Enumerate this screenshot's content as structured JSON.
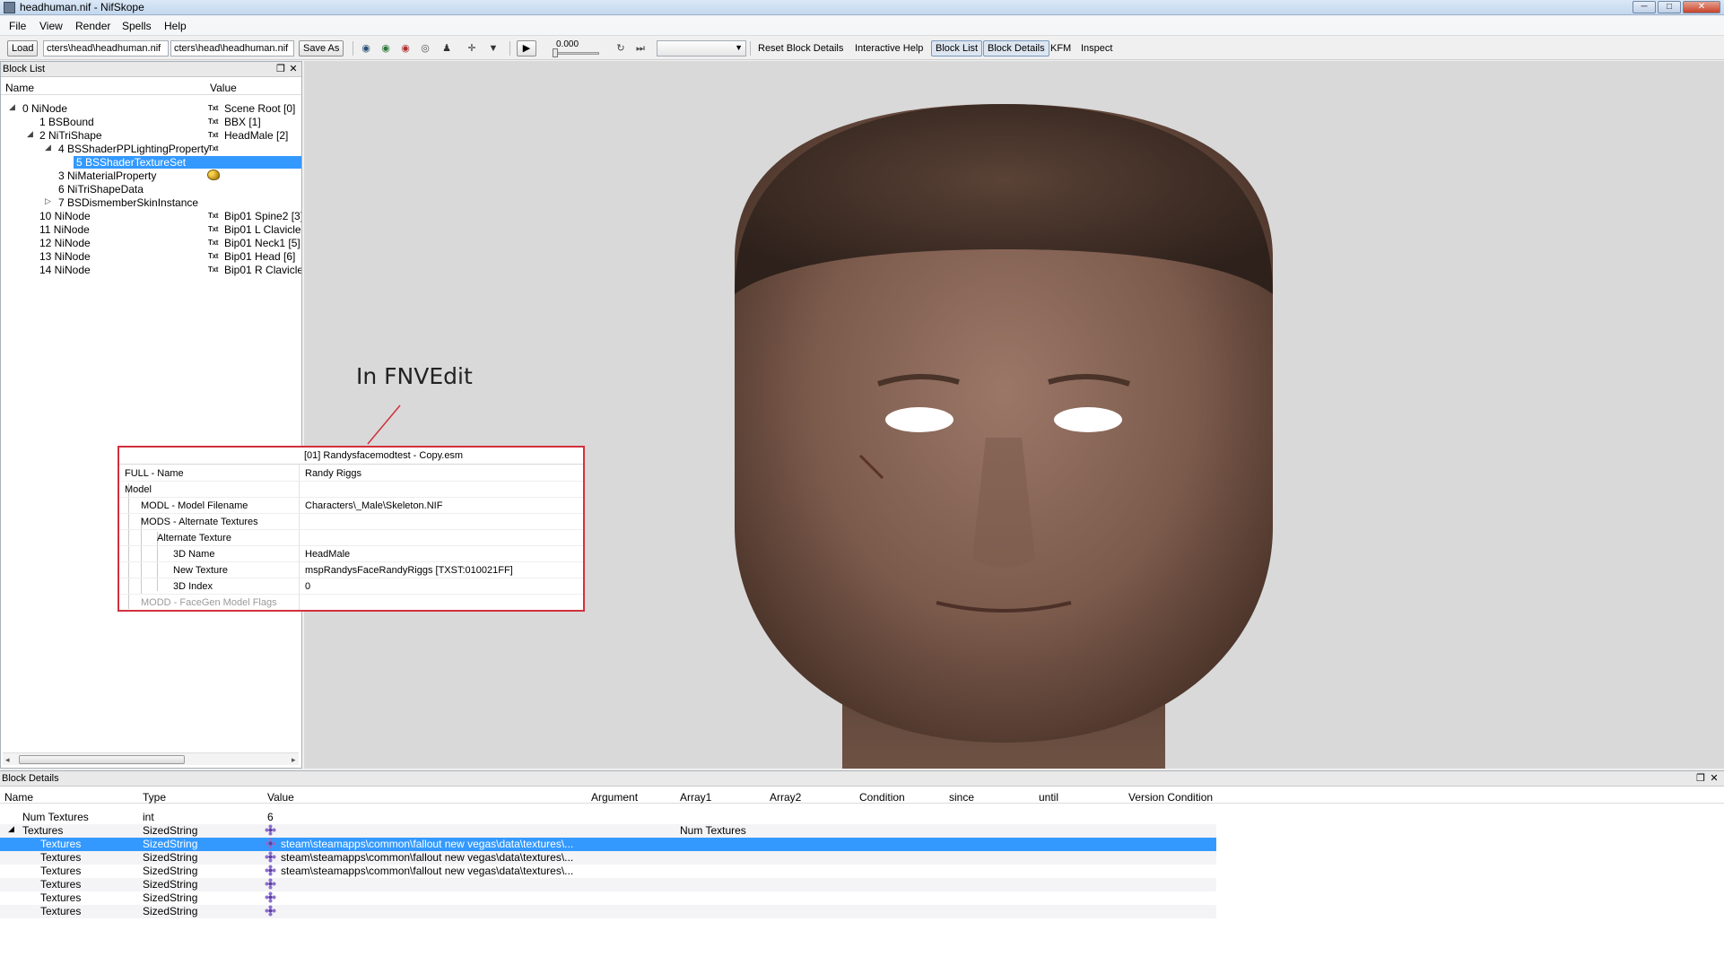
{
  "window": {
    "title": "headhuman.nif - NifSkope",
    "minimize": "─",
    "maximize": "□",
    "close": "✕"
  },
  "menu": [
    "File",
    "View",
    "Render",
    "Spells",
    "Help"
  ],
  "toolbar": {
    "load_label": "Load",
    "load_path": "cters\\head\\headhuman.nif",
    "save_path": "cters\\head\\headhuman.nif",
    "save_as_label": "Save As",
    "time_value": "0.000",
    "reset_block_details": "Reset Block Details",
    "interactive_help": "Interactive Help",
    "block_list": "Block List",
    "block_details": "Block Details",
    "kfm": "KFM",
    "inspect": "Inspect",
    "icons": [
      "eye-blue-icon",
      "eye-green-icon",
      "eye-red-icon",
      "eye-outline-icon",
      "walk-icon",
      "move-axis-icon",
      "dropdown-icon",
      "play-icon",
      "loop-icon",
      "switch-icon"
    ]
  },
  "block_list": {
    "title": "Block List",
    "col_name": "Name",
    "col_value": "Value",
    "txt_badge": "Txt",
    "rows": [
      {
        "name": "0 NiNode",
        "value": "Scene Root [0]",
        "txt": true,
        "expander": "◢"
      },
      {
        "name": "1 BSBound",
        "value": "BBX [1]",
        "txt": true,
        "expander": ""
      },
      {
        "name": "2 NiTriShape",
        "value": "HeadMale [2]",
        "txt": true,
        "expander": "◢"
      },
      {
        "name": "4 BSShaderPPLightingProperty",
        "value": "",
        "txt": true,
        "expander": "◢"
      },
      {
        "name": "5 BSShaderTextureSet",
        "value": "",
        "txt": false,
        "expander": ""
      },
      {
        "name": "3 NiMaterialProperty",
        "value": "",
        "txt": false,
        "expander": ""
      },
      {
        "name": "6 NiTriShapeData",
        "value": "",
        "txt": false,
        "expander": ""
      },
      {
        "name": "7 BSDismemberSkinInstance",
        "value": "",
        "txt": false,
        "expander": "▷"
      },
      {
        "name": "10 NiNode",
        "value": "Bip01 Spine2 [3]",
        "txt": true,
        "expander": ""
      },
      {
        "name": "11 NiNode",
        "value": "Bip01 L Clavicle [",
        "txt": true,
        "expander": ""
      },
      {
        "name": "12 NiNode",
        "value": "Bip01 Neck1 [5]",
        "txt": true,
        "expander": ""
      },
      {
        "name": "13 NiNode",
        "value": "Bip01 Head [6]",
        "txt": true,
        "expander": ""
      },
      {
        "name": "14 NiNode",
        "value": "Bip01 R Clavicle",
        "txt": true,
        "expander": ""
      }
    ]
  },
  "annotation": {
    "label": "In FNVEdit"
  },
  "fnvedit": {
    "header": "[01] Randysfacemodtest - Copy.esm",
    "rows": [
      {
        "key": "FULL - Name",
        "value": "Randy Riggs"
      },
      {
        "key": "Model",
        "value": ""
      },
      {
        "key": "MODL - Model Filename",
        "value": "Characters\\_Male\\Skeleton.NIF"
      },
      {
        "key": "MODS - Alternate Textures",
        "value": ""
      },
      {
        "key": "Alternate Texture",
        "value": ""
      },
      {
        "key": "3D Name",
        "value": "HeadMale"
      },
      {
        "key": "New Texture",
        "value": "mspRandysFaceRandyRiggs [TXST:010021FF]"
      },
      {
        "key": "3D Index",
        "value": "0"
      },
      {
        "key": "MODD - FaceGen Model Flags",
        "value": ""
      }
    ]
  },
  "block_details": {
    "title": "Block Details",
    "columns": [
      "Name",
      "Type",
      "Value",
      "Argument",
      "Array1",
      "Array2",
      "Condition",
      "since",
      "until",
      "Version Condition"
    ],
    "rows": [
      {
        "name": "Num Textures",
        "type": "int",
        "value": "6",
        "array1": "",
        "flower": false
      },
      {
        "name": "Textures",
        "type": "SizedString",
        "value": "",
        "array1": "Num Textures",
        "flower": true
      },
      {
        "name": "Textures",
        "type": "SizedString",
        "value": "steam\\steamapps\\common\\fallout new vegas\\data\\textures\\...",
        "array1": "",
        "flower": true
      },
      {
        "name": "Textures",
        "type": "SizedString",
        "value": "steam\\steamapps\\common\\fallout new vegas\\data\\textures\\...",
        "array1": "",
        "flower": true
      },
      {
        "name": "Textures",
        "type": "SizedString",
        "value": "steam\\steamapps\\common\\fallout new vegas\\data\\textures\\...",
        "array1": "",
        "flower": true
      },
      {
        "name": "Textures",
        "type": "SizedString",
        "value": "",
        "array1": "",
        "flower": true
      },
      {
        "name": "Textures",
        "type": "SizedString",
        "value": "",
        "array1": "",
        "flower": true
      },
      {
        "name": "Textures",
        "type": "SizedString",
        "value": "",
        "array1": "",
        "flower": true
      }
    ]
  },
  "colors": {
    "selection": "#3399ff",
    "annotation_border": "#d2303d",
    "viewport_bg": "#d9d9d9"
  }
}
